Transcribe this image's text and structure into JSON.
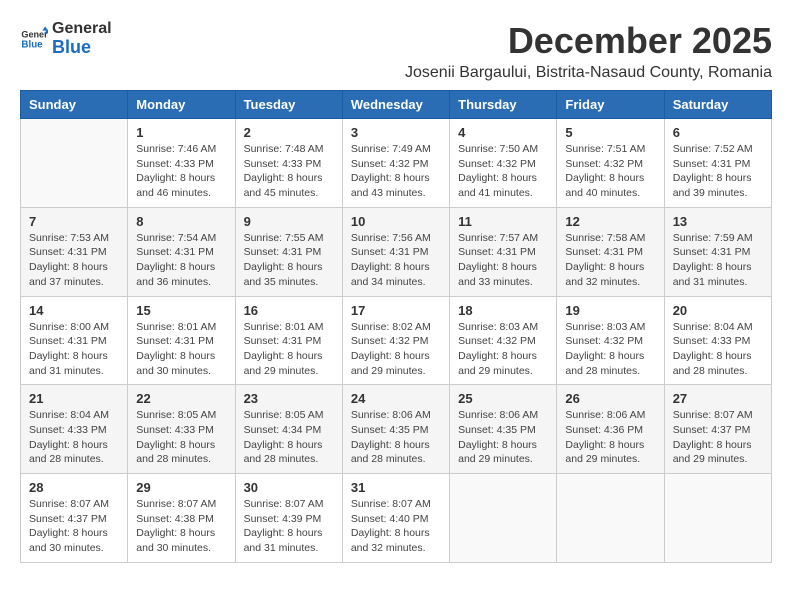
{
  "logo": {
    "general": "General",
    "blue": "Blue"
  },
  "title": "December 2025",
  "subtitle": "Josenii Bargaului, Bistrita-Nasaud County, Romania",
  "weekdays": [
    "Sunday",
    "Monday",
    "Tuesday",
    "Wednesday",
    "Thursday",
    "Friday",
    "Saturday"
  ],
  "weeks": [
    [
      {
        "day": "",
        "sunrise": "",
        "sunset": "",
        "daylight": ""
      },
      {
        "day": "1",
        "sunrise": "Sunrise: 7:46 AM",
        "sunset": "Sunset: 4:33 PM",
        "daylight": "Daylight: 8 hours and 46 minutes."
      },
      {
        "day": "2",
        "sunrise": "Sunrise: 7:48 AM",
        "sunset": "Sunset: 4:33 PM",
        "daylight": "Daylight: 8 hours and 45 minutes."
      },
      {
        "day": "3",
        "sunrise": "Sunrise: 7:49 AM",
        "sunset": "Sunset: 4:32 PM",
        "daylight": "Daylight: 8 hours and 43 minutes."
      },
      {
        "day": "4",
        "sunrise": "Sunrise: 7:50 AM",
        "sunset": "Sunset: 4:32 PM",
        "daylight": "Daylight: 8 hours and 41 minutes."
      },
      {
        "day": "5",
        "sunrise": "Sunrise: 7:51 AM",
        "sunset": "Sunset: 4:32 PM",
        "daylight": "Daylight: 8 hours and 40 minutes."
      },
      {
        "day": "6",
        "sunrise": "Sunrise: 7:52 AM",
        "sunset": "Sunset: 4:31 PM",
        "daylight": "Daylight: 8 hours and 39 minutes."
      }
    ],
    [
      {
        "day": "7",
        "sunrise": "Sunrise: 7:53 AM",
        "sunset": "Sunset: 4:31 PM",
        "daylight": "Daylight: 8 hours and 37 minutes."
      },
      {
        "day": "8",
        "sunrise": "Sunrise: 7:54 AM",
        "sunset": "Sunset: 4:31 PM",
        "daylight": "Daylight: 8 hours and 36 minutes."
      },
      {
        "day": "9",
        "sunrise": "Sunrise: 7:55 AM",
        "sunset": "Sunset: 4:31 PM",
        "daylight": "Daylight: 8 hours and 35 minutes."
      },
      {
        "day": "10",
        "sunrise": "Sunrise: 7:56 AM",
        "sunset": "Sunset: 4:31 PM",
        "daylight": "Daylight: 8 hours and 34 minutes."
      },
      {
        "day": "11",
        "sunrise": "Sunrise: 7:57 AM",
        "sunset": "Sunset: 4:31 PM",
        "daylight": "Daylight: 8 hours and 33 minutes."
      },
      {
        "day": "12",
        "sunrise": "Sunrise: 7:58 AM",
        "sunset": "Sunset: 4:31 PM",
        "daylight": "Daylight: 8 hours and 32 minutes."
      },
      {
        "day": "13",
        "sunrise": "Sunrise: 7:59 AM",
        "sunset": "Sunset: 4:31 PM",
        "daylight": "Daylight: 8 hours and 31 minutes."
      }
    ],
    [
      {
        "day": "14",
        "sunrise": "Sunrise: 8:00 AM",
        "sunset": "Sunset: 4:31 PM",
        "daylight": "Daylight: 8 hours and 31 minutes."
      },
      {
        "day": "15",
        "sunrise": "Sunrise: 8:01 AM",
        "sunset": "Sunset: 4:31 PM",
        "daylight": "Daylight: 8 hours and 30 minutes."
      },
      {
        "day": "16",
        "sunrise": "Sunrise: 8:01 AM",
        "sunset": "Sunset: 4:31 PM",
        "daylight": "Daylight: 8 hours and 29 minutes."
      },
      {
        "day": "17",
        "sunrise": "Sunrise: 8:02 AM",
        "sunset": "Sunset: 4:32 PM",
        "daylight": "Daylight: 8 hours and 29 minutes."
      },
      {
        "day": "18",
        "sunrise": "Sunrise: 8:03 AM",
        "sunset": "Sunset: 4:32 PM",
        "daylight": "Daylight: 8 hours and 29 minutes."
      },
      {
        "day": "19",
        "sunrise": "Sunrise: 8:03 AM",
        "sunset": "Sunset: 4:32 PM",
        "daylight": "Daylight: 8 hours and 28 minutes."
      },
      {
        "day": "20",
        "sunrise": "Sunrise: 8:04 AM",
        "sunset": "Sunset: 4:33 PM",
        "daylight": "Daylight: 8 hours and 28 minutes."
      }
    ],
    [
      {
        "day": "21",
        "sunrise": "Sunrise: 8:04 AM",
        "sunset": "Sunset: 4:33 PM",
        "daylight": "Daylight: 8 hours and 28 minutes."
      },
      {
        "day": "22",
        "sunrise": "Sunrise: 8:05 AM",
        "sunset": "Sunset: 4:33 PM",
        "daylight": "Daylight: 8 hours and 28 minutes."
      },
      {
        "day": "23",
        "sunrise": "Sunrise: 8:05 AM",
        "sunset": "Sunset: 4:34 PM",
        "daylight": "Daylight: 8 hours and 28 minutes."
      },
      {
        "day": "24",
        "sunrise": "Sunrise: 8:06 AM",
        "sunset": "Sunset: 4:35 PM",
        "daylight": "Daylight: 8 hours and 28 minutes."
      },
      {
        "day": "25",
        "sunrise": "Sunrise: 8:06 AM",
        "sunset": "Sunset: 4:35 PM",
        "daylight": "Daylight: 8 hours and 29 minutes."
      },
      {
        "day": "26",
        "sunrise": "Sunrise: 8:06 AM",
        "sunset": "Sunset: 4:36 PM",
        "daylight": "Daylight: 8 hours and 29 minutes."
      },
      {
        "day": "27",
        "sunrise": "Sunrise: 8:07 AM",
        "sunset": "Sunset: 4:37 PM",
        "daylight": "Daylight: 8 hours and 29 minutes."
      }
    ],
    [
      {
        "day": "28",
        "sunrise": "Sunrise: 8:07 AM",
        "sunset": "Sunset: 4:37 PM",
        "daylight": "Daylight: 8 hours and 30 minutes."
      },
      {
        "day": "29",
        "sunrise": "Sunrise: 8:07 AM",
        "sunset": "Sunset: 4:38 PM",
        "daylight": "Daylight: 8 hours and 30 minutes."
      },
      {
        "day": "30",
        "sunrise": "Sunrise: 8:07 AM",
        "sunset": "Sunset: 4:39 PM",
        "daylight": "Daylight: 8 hours and 31 minutes."
      },
      {
        "day": "31",
        "sunrise": "Sunrise: 8:07 AM",
        "sunset": "Sunset: 4:40 PM",
        "daylight": "Daylight: 8 hours and 32 minutes."
      },
      {
        "day": "",
        "sunrise": "",
        "sunset": "",
        "daylight": ""
      },
      {
        "day": "",
        "sunrise": "",
        "sunset": "",
        "daylight": ""
      },
      {
        "day": "",
        "sunrise": "",
        "sunset": "",
        "daylight": ""
      }
    ]
  ]
}
